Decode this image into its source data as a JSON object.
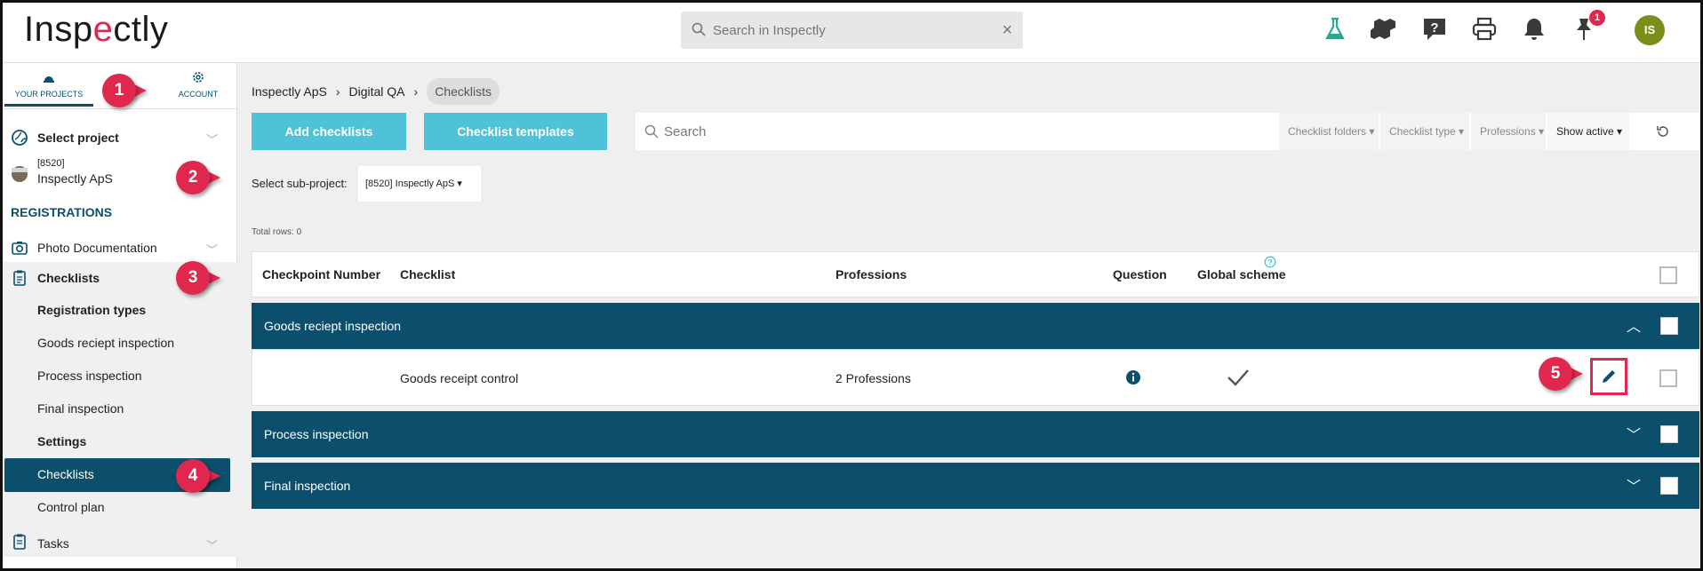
{
  "app": {
    "logo_left": "Insp",
    "logo_accent": "e",
    "logo_right": "ctly"
  },
  "header": {
    "search_placeholder": "Search in Inspectly",
    "notification_count": "1",
    "avatar_initials": "IS"
  },
  "sidebar": {
    "tabs": [
      {
        "label": "YOUR PROJECTS"
      },
      {
        "label": "ACCOUNT"
      }
    ],
    "select_project": "Select project",
    "project_code": "[8520]",
    "project_name": "Inspectly ApS",
    "registrations_title": "REGISTRATIONS",
    "items": [
      {
        "label": "Photo Documentation"
      },
      {
        "label": "Checklists"
      },
      {
        "label": "Registration types"
      },
      {
        "label": "Goods reciept inspection"
      },
      {
        "label": "Process inspection"
      },
      {
        "label": "Final inspection"
      },
      {
        "label": "Settings"
      },
      {
        "label": "Checklists"
      },
      {
        "label": "Control plan"
      },
      {
        "label": "Tasks"
      }
    ]
  },
  "breadcrumb": [
    "Inspectly ApS",
    "Digital QA",
    "Checklists"
  ],
  "toolbar": {
    "add_label": "Add checklists",
    "templates_label": "Checklist templates",
    "search_placeholder": "Search",
    "filters": [
      "Checklist folders",
      "Checklist type",
      "Professions",
      "Show active"
    ]
  },
  "subproject": {
    "label": "Select sub-project:",
    "value": "[8520] Inspectly ApS"
  },
  "total_rows": "Total rows: 0",
  "table": {
    "headers": [
      "Checkpoint Number",
      "Checklist",
      "Professions",
      "Question",
      "Global scheme"
    ],
    "groups": [
      {
        "name": "Goods reciept inspection",
        "expanded": true
      },
      {
        "name": "Process inspection",
        "expanded": false
      },
      {
        "name": "Final inspection",
        "expanded": false
      }
    ],
    "row": {
      "checklist": "Goods receipt control",
      "professions": "2 Professions"
    }
  },
  "callouts": [
    "1",
    "2",
    "3",
    "4",
    "5"
  ],
  "colors": {
    "brand": "#0b4f6c",
    "accent": "#e0284e",
    "teal": "#4fc2d8"
  }
}
